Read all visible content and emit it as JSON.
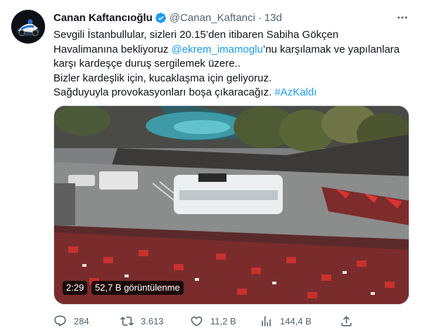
{
  "author": {
    "name": "Canan Kaftancıoğlu",
    "handle": "@Canan_Kaftanci",
    "separator": "·",
    "time": "13d"
  },
  "tweet": {
    "line1": "Sevgili İstanbullular, sizleri 20.15’den itibaren Sabiha Gökçen",
    "line2_pre": "Havalimanına bekliyoruz ",
    "mention": "@ekrem_imamoglu",
    "line2_post": "’nu karşılamak ve yapılanlara",
    "line3": "karşı kardeşçe duruş sergilemek üzere..",
    "line4": "Bizler kardeşlik için, kucaklaşma için geliyoruz.",
    "line5_pre": "Sağduyuyla provokasyonları boşa çıkaracağız.  ",
    "hashtag": "#AzKaldı"
  },
  "media": {
    "duration": "2:29",
    "views": "52,7 B görüntülenme"
  },
  "actions": {
    "replies": "284",
    "retweets": "3.613",
    "likes": "11,2 B",
    "views": "144,4 B"
  },
  "icons": {
    "verified": "verified-badge-icon",
    "more": "more-options-icon",
    "reply": "reply-icon",
    "retweet": "retweet-icon",
    "like": "heart-icon",
    "views": "views-bar-chart-icon",
    "share": "share-icon"
  },
  "colors": {
    "link": "#1d9bf0",
    "secondary_text": "#536471",
    "primary_text": "#0f1419",
    "verified": "#1d9bf0"
  }
}
